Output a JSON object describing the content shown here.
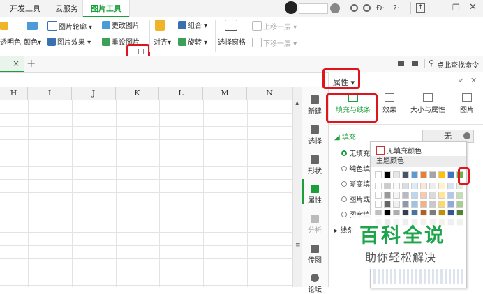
{
  "tabs": {
    "dev_tools": "开发工具",
    "cloud": "云服务",
    "picture_tools": "图片工具"
  },
  "ribbon": {
    "transparent": "透明色",
    "color": "颜色",
    "outline": "图片轮廓",
    "effect": "图片效果",
    "change": "更改图片",
    "reset": "重设图片",
    "align": "对齐",
    "rotate": "旋转",
    "group": "组合",
    "selection_pane": "选择窗格",
    "bring_forward": "上移一层",
    "send_backward": "下移一层"
  },
  "docbar": {
    "close": "×",
    "add": "+",
    "search": "点此查找命令"
  },
  "columns": [
    "H",
    "I",
    "J",
    "K",
    "L",
    "M",
    "N"
  ],
  "sidebar": [
    "新建",
    "选择",
    "形状",
    "属性",
    "分析",
    "传图",
    "论坛"
  ],
  "panel": {
    "title": "属性",
    "tabs": [
      "填充与线条",
      "效果",
      "大小与属性",
      "图片"
    ],
    "section": "填充",
    "fill_value": "无",
    "options": [
      "无填充",
      "纯色填充",
      "渐变填充",
      "图片或纹理填充",
      "图案填充"
    ],
    "line_section": "线条"
  },
  "dropdown": {
    "no_fill": "无填充颜色",
    "theme_colors": "主题颜色"
  },
  "colors": {
    "theme_row": [
      "#ffffff",
      "#000000",
      "#e7e6e6",
      "#44546a",
      "#5b9bd5",
      "#ed7d31",
      "#a5a5a5",
      "#ffc000",
      "#4472c4",
      "#70ad47"
    ],
    "accent_green": "#1a9f3a",
    "highlight_red": "#e0141c",
    "watermark_green": "#1ea44a"
  },
  "watermark": {
    "title": "百科全说",
    "subtitle": "助你轻松解决"
  }
}
